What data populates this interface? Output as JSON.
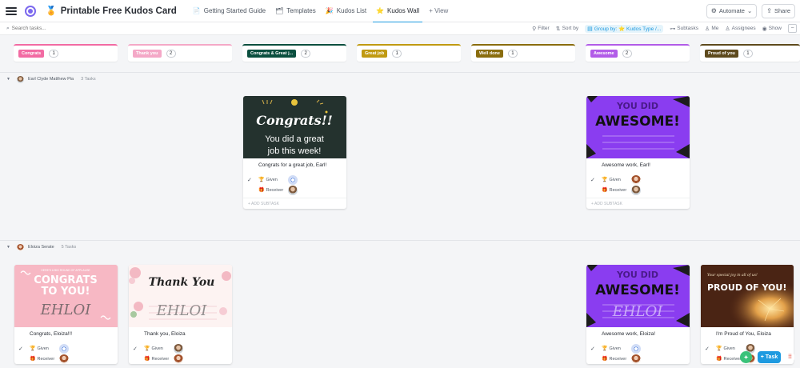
{
  "app": {
    "list_title": "Printable Free Kudos Card",
    "tabs": [
      {
        "label": "Getting Started Guide",
        "icon": "📄"
      },
      {
        "label": "Templates",
        "icon": "🗂"
      },
      {
        "label": "Kudos List",
        "icon": "🎉"
      },
      {
        "label": "Kudos Wall",
        "icon": "⭐"
      }
    ],
    "add_view_label": "+ View",
    "automate_label": "Automate",
    "share_label": "Share"
  },
  "toolbar": {
    "search_placeholder": "Search tasks...",
    "filter_label": "Filter",
    "sort_label": "Sort by",
    "group_by_label": "Group by: ⭐ Kudos Type /...",
    "subtasks_label": "Subtasks",
    "me_label": "Me",
    "assignees_label": "Assignees",
    "show_label": "Show"
  },
  "columns": [
    {
      "label": "Congrats",
      "count": "1",
      "color": "#f26ba3"
    },
    {
      "label": "Thank you",
      "count": "2",
      "color": "#f4a8c7"
    },
    {
      "label": "Congrats & Great j...",
      "count": "2",
      "color": "#0b4f3f"
    },
    {
      "label": "Great job",
      "count": "1",
      "color": "#c09a12"
    },
    {
      "label": "Well done",
      "count": "1",
      "color": "#8a6d0e"
    },
    {
      "label": "Awesome",
      "count": "2",
      "color": "#b25ce8"
    },
    {
      "label": "Proud of you",
      "count": "1",
      "color": "#5e4a1d"
    }
  ],
  "groups": [
    {
      "name": "Earl Clyde Matthew Pia",
      "tasks": "3 Tasks"
    },
    {
      "name": "Eloiza Serate",
      "tasks": "5 Tasks"
    }
  ],
  "cards": {
    "g1_congrats_great": {
      "cover_line1": "Congrats!!",
      "cover_line2": "You did a great",
      "cover_line3": "job this week!",
      "name": "Congrats for a great job, Earl!",
      "given_label": "Given",
      "receiver_label": "Receiver",
      "add_subtask": "+ ADD SUBTASK"
    },
    "g1_awesome": {
      "cover_line1": "YOU DID",
      "cover_line2": "AWESOME!",
      "name": "Awesome work, Earl!",
      "given_label": "Given",
      "receiver_label": "Receiver",
      "add_subtask": "+ ADD SUBTASK"
    },
    "g2_congrats": {
      "cover_small": "HERE'S A BIG ROUND OF APPLAUSE",
      "cover_line1": "CONGRATS",
      "cover_line2": "TO YOU!",
      "cover_sign": "EHLOI",
      "name": "Congrats, Eloiza!!!",
      "given_label": "Given",
      "receiver_label": "Receiver"
    },
    "g2_thankyou": {
      "cover_line1": "Thank You",
      "cover_sign": "EHLOI",
      "name": "Thank you, Eloiza",
      "given_label": "Given",
      "receiver_label": "Receiver"
    },
    "g2_awesome": {
      "cover_line1": "YOU DID",
      "cover_line2": "AWESOME!",
      "cover_sign": "EHLOI",
      "name": "Awesome work, Eloiza!",
      "given_label": "Given",
      "receiver_label": "Receiver"
    },
    "g2_proud": {
      "cover_small": "Your special joy in all of us!",
      "cover_line1": "PROUD OF YOU!",
      "name": "I'm Proud of You, Eloiza",
      "given_label": "Given",
      "receiver_label": "Receiver"
    }
  },
  "fab": {
    "task_label": "+ Task"
  }
}
